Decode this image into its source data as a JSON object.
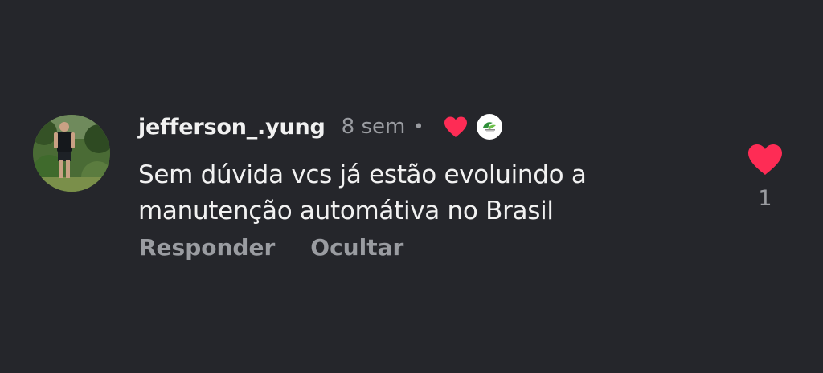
{
  "comment": {
    "username": "jefferson_.yung",
    "time": "8 sem",
    "separator": "•",
    "text_line1": "Sem dúvida vcs já estão evoluindo a",
    "text_line2": "manutenção automátiva no Brasil",
    "actions": {
      "reply": "Responder",
      "hide": "Ocultar"
    },
    "like_count": "1",
    "colors": {
      "background": "#25262b",
      "heart": "#fe2c55",
      "text": "#f1f1f1",
      "muted": "#9a9ca1"
    },
    "icons": {
      "creator_liked": "heart-icon",
      "creator_badge": "creator-avatar-icon",
      "like": "heart-icon"
    }
  }
}
